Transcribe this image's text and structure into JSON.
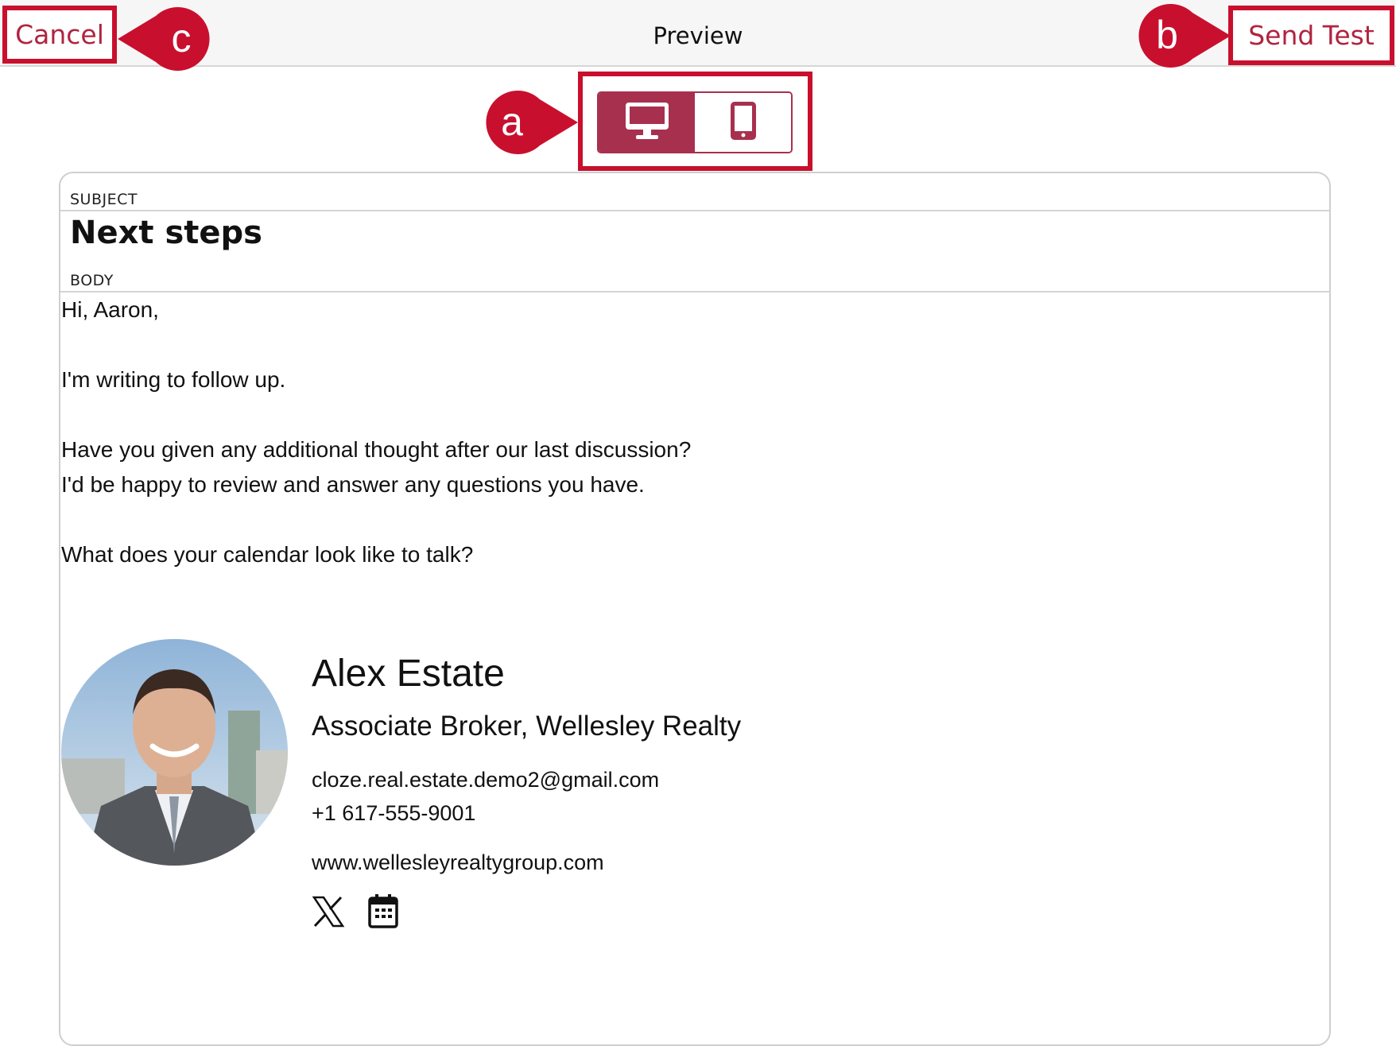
{
  "header": {
    "title": "Preview",
    "cancel_label": "Cancel",
    "send_test_label": "Send Test"
  },
  "callouts": {
    "a": "a",
    "b": "b",
    "c": "c"
  },
  "view_toggle": {
    "options": [
      {
        "name": "desktop",
        "icon": "desktop-icon",
        "selected": true
      },
      {
        "name": "mobile",
        "icon": "mobile-icon",
        "selected": false
      }
    ]
  },
  "email": {
    "subject_label": "SUBJECT",
    "subject": "Next steps",
    "body_label": "BODY",
    "body_lines": [
      "Hi, Aaron,",
      "I'm writing to follow up.",
      "Have you given any additional thought after our last discussion?",
      "I'd be happy to review and answer any questions you have.",
      "What does your calendar look like to talk?"
    ]
  },
  "signature": {
    "name": "Alex Estate",
    "role": "Associate Broker, Wellesley Realty",
    "email": "cloze.real.estate.demo2@gmail.com",
    "phone": "+1 617-555-9001",
    "website": "www.wellesleyrealtygroup.com",
    "social_icons": [
      "x-icon",
      "calendar-icon"
    ]
  },
  "colors": {
    "accent": "#c8102e",
    "brand": "#a8304f",
    "link_text": "#b0243f"
  }
}
